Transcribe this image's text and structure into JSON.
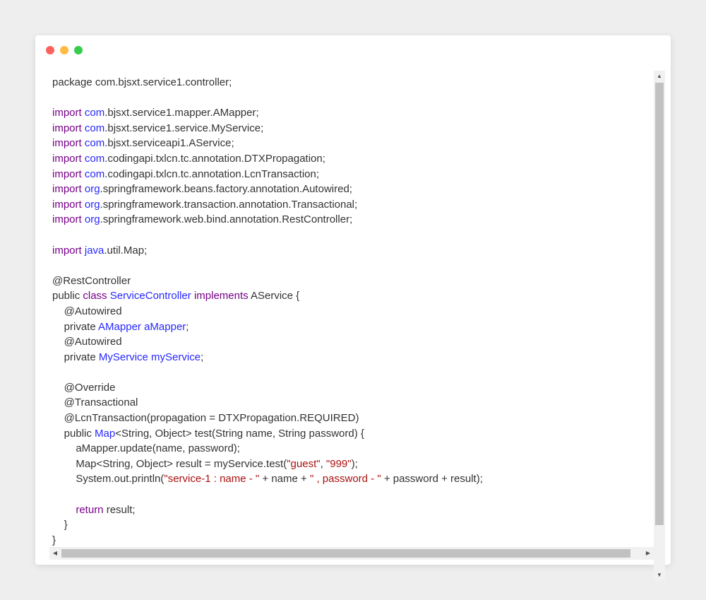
{
  "window": {
    "controls": [
      "close",
      "minimize",
      "maximize"
    ],
    "colors": {
      "close": "#fc625d",
      "minimize": "#fdbc40",
      "maximize": "#35cd4b"
    }
  },
  "code": {
    "lines": [
      [
        {
          "t": "package com.bjsxt.service1.controller;",
          "c": ""
        }
      ],
      [],
      [
        {
          "t": "import",
          "c": "kw"
        },
        {
          "t": " ",
          "c": ""
        },
        {
          "t": "com",
          "c": "ty"
        },
        {
          "t": ".bjsxt.service1.mapper.AMapper;",
          "c": ""
        }
      ],
      [
        {
          "t": "import",
          "c": "kw"
        },
        {
          "t": " ",
          "c": ""
        },
        {
          "t": "com",
          "c": "ty"
        },
        {
          "t": ".bjsxt.service1.service.MyService;",
          "c": ""
        }
      ],
      [
        {
          "t": "import",
          "c": "kw"
        },
        {
          "t": " ",
          "c": ""
        },
        {
          "t": "com",
          "c": "ty"
        },
        {
          "t": ".bjsxt.serviceapi1.AService;",
          "c": ""
        }
      ],
      [
        {
          "t": "import",
          "c": "kw"
        },
        {
          "t": " ",
          "c": ""
        },
        {
          "t": "com",
          "c": "ty"
        },
        {
          "t": ".codingapi.txlcn.tc.annotation.DTXPropagation;",
          "c": ""
        }
      ],
      [
        {
          "t": "import",
          "c": "kw"
        },
        {
          "t": " ",
          "c": ""
        },
        {
          "t": "com",
          "c": "ty"
        },
        {
          "t": ".codingapi.txlcn.tc.annotation.LcnTransaction;",
          "c": ""
        }
      ],
      [
        {
          "t": "import",
          "c": "kw"
        },
        {
          "t": " ",
          "c": ""
        },
        {
          "t": "org",
          "c": "ty"
        },
        {
          "t": ".springframework.beans.factory.annotation.Autowired;",
          "c": ""
        }
      ],
      [
        {
          "t": "import",
          "c": "kw"
        },
        {
          "t": " ",
          "c": ""
        },
        {
          "t": "org",
          "c": "ty"
        },
        {
          "t": ".springframework.transaction.annotation.Transactional;",
          "c": ""
        }
      ],
      [
        {
          "t": "import",
          "c": "kw"
        },
        {
          "t": " ",
          "c": ""
        },
        {
          "t": "org",
          "c": "ty"
        },
        {
          "t": ".springframework.web.bind.annotation.RestController;",
          "c": ""
        }
      ],
      [],
      [
        {
          "t": "import",
          "c": "kw"
        },
        {
          "t": " ",
          "c": ""
        },
        {
          "t": "java",
          "c": "ty"
        },
        {
          "t": ".util.Map;",
          "c": ""
        }
      ],
      [],
      [
        {
          "t": "@RestController",
          "c": ""
        }
      ],
      [
        {
          "t": "public ",
          "c": ""
        },
        {
          "t": "class",
          "c": "kw"
        },
        {
          "t": " ",
          "c": ""
        },
        {
          "t": "ServiceController",
          "c": "ty"
        },
        {
          "t": " ",
          "c": ""
        },
        {
          "t": "implements",
          "c": "kw"
        },
        {
          "t": " AService {",
          "c": ""
        }
      ],
      [
        {
          "t": "    @Autowired",
          "c": ""
        }
      ],
      [
        {
          "t": "    private ",
          "c": ""
        },
        {
          "t": "AMapper aMapper",
          "c": "ty"
        },
        {
          "t": ";",
          "c": ""
        }
      ],
      [
        {
          "t": "    @Autowired",
          "c": ""
        }
      ],
      [
        {
          "t": "    private ",
          "c": ""
        },
        {
          "t": "MyService myService",
          "c": "ty"
        },
        {
          "t": ";",
          "c": ""
        }
      ],
      [],
      [
        {
          "t": "    @Override",
          "c": ""
        }
      ],
      [
        {
          "t": "    @Transactional",
          "c": ""
        }
      ],
      [
        {
          "t": "    @LcnTransaction(propagation = DTXPropagation.REQUIRED)",
          "c": ""
        }
      ],
      [
        {
          "t": "    public ",
          "c": ""
        },
        {
          "t": "Map",
          "c": "ty"
        },
        {
          "t": "<String, Object> test(String name, String password) {",
          "c": ""
        }
      ],
      [
        {
          "t": "        aMapper.update(name, password);",
          "c": ""
        }
      ],
      [
        {
          "t": "        Map<String, Object> result = myService.test(",
          "c": ""
        },
        {
          "t": "\"guest\"",
          "c": "str"
        },
        {
          "t": ", ",
          "c": ""
        },
        {
          "t": "\"999\"",
          "c": "str"
        },
        {
          "t": ");",
          "c": ""
        }
      ],
      [
        {
          "t": "        System.out.println(",
          "c": ""
        },
        {
          "t": "\"service-1 : name - \"",
          "c": "str"
        },
        {
          "t": " + name + ",
          "c": ""
        },
        {
          "t": "\" , password - \"",
          "c": "str"
        },
        {
          "t": " + password + result);",
          "c": ""
        }
      ],
      [],
      [
        {
          "t": "        ",
          "c": ""
        },
        {
          "t": "return",
          "c": "kw"
        },
        {
          "t": " result;",
          "c": ""
        }
      ],
      [
        {
          "t": "    }",
          "c": ""
        }
      ],
      [
        {
          "t": "}",
          "c": ""
        }
      ]
    ]
  },
  "scrollbars": {
    "vertical": {
      "up_icon": "▲",
      "down_icon": "▼"
    },
    "horizontal": {
      "left_icon": "◀",
      "right_icon": "▶"
    }
  }
}
